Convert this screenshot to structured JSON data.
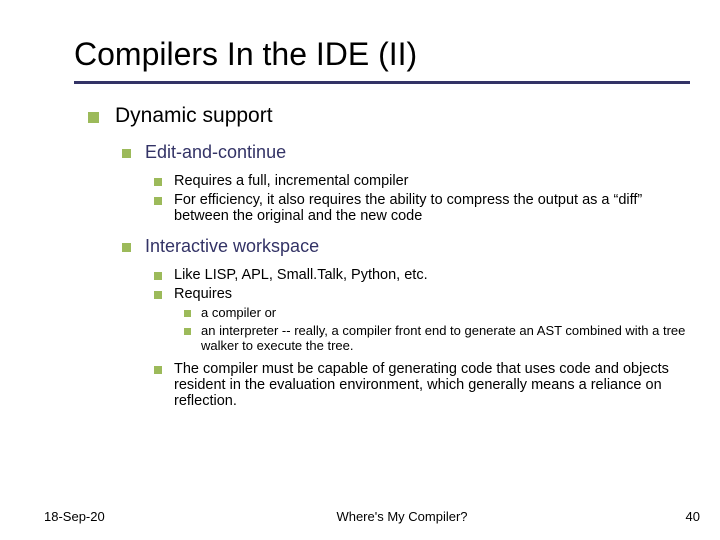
{
  "title": "Compilers In the IDE (II)",
  "lv1": "Dynamic support",
  "sec1": {
    "head": "Edit-and-continue",
    "p1": "Requires a full, incremental compiler",
    "p2": "For efficiency, it also requires the ability to compress the output as a “diff” between the original and the new code"
  },
  "sec2": {
    "head": "Interactive workspace",
    "p1": "Like LISP, APL, Small.Talk, Python, etc.",
    "p2": "Requires",
    "sub1": "a compiler or",
    "sub2": "an interpreter -- really, a compiler front end to generate an AST combined with a tree walker to execute the tree.",
    "p3": "The compiler must be capable of generating code that uses code and objects resident in the evaluation environment, which generally means a reliance on reflection."
  },
  "footer": {
    "date": "18-Sep-20",
    "title": "Where's My Compiler?",
    "page": "40"
  }
}
